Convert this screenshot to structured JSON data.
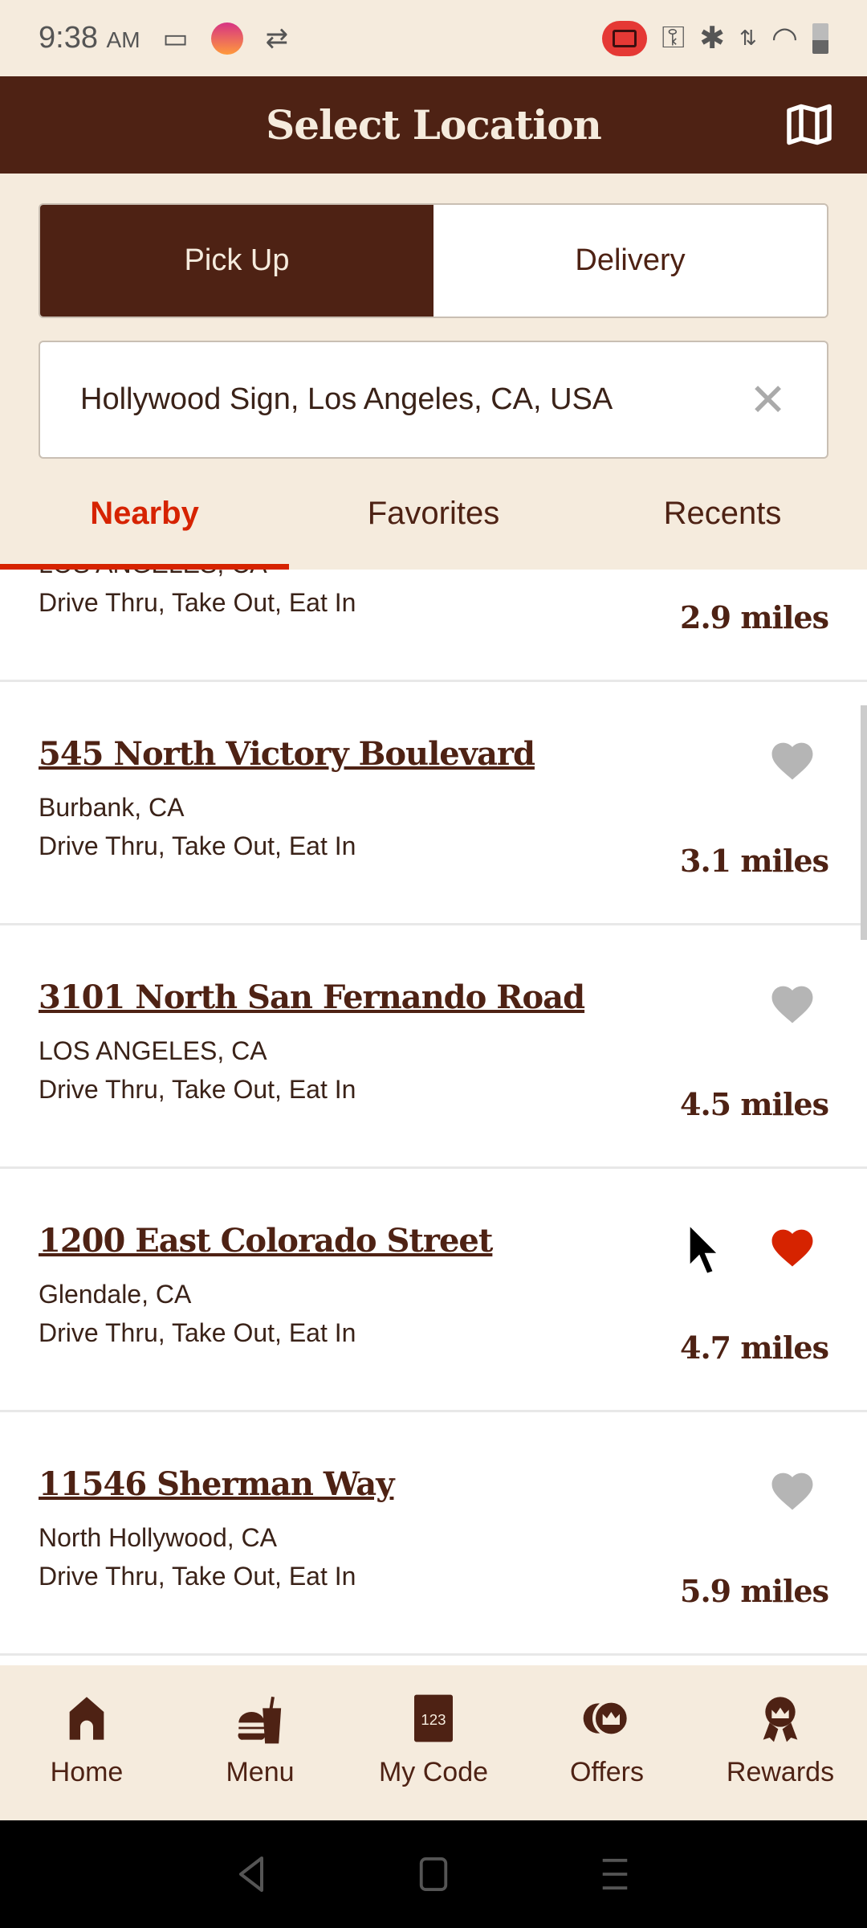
{
  "status_bar": {
    "time": "9:38",
    "ampm": "AM"
  },
  "header": {
    "title": "Select Location",
    "map_icon": "map-icon"
  },
  "mode_toggle": {
    "options": [
      "Pick Up",
      "Delivery"
    ],
    "selected": "Pick Up"
  },
  "search": {
    "value": "Hollywood Sign, Los Angeles, CA, USA"
  },
  "tabs": [
    {
      "label": "Nearby",
      "active": true
    },
    {
      "label": "Favorites"
    },
    {
      "label": "Recents"
    }
  ],
  "locations": [
    {
      "title": "",
      "city": "LOS ANGELES, CA",
      "services": "Drive Thru, Take Out, Eat In",
      "distance": "2.9 miles",
      "favorite": false
    },
    {
      "title": "545 North Victory Boulevard",
      "city": "Burbank, CA",
      "services": "Drive Thru, Take Out, Eat In",
      "distance": "3.1 miles",
      "favorite": false
    },
    {
      "title": "3101 North San Fernando Road",
      "city": "LOS ANGELES, CA",
      "services": "Drive Thru, Take Out, Eat In",
      "distance": "4.5 miles",
      "favorite": false
    },
    {
      "title": "1200 East Colorado Street",
      "city": "Glendale, CA",
      "services": "Drive Thru, Take Out, Eat In",
      "distance": "4.7 miles",
      "favorite": true
    },
    {
      "title": "11546 Sherman Way",
      "city": "North Hollywood, CA",
      "services": "Drive Thru, Take Out, Eat In",
      "distance": "5.9 miles",
      "favorite": false
    }
  ],
  "bottom_nav": [
    {
      "label": "Home",
      "icon": "home-icon"
    },
    {
      "label": "Menu",
      "icon": "menu-icon"
    },
    {
      "label": "My Code",
      "icon": "code-icon",
      "code": "123"
    },
    {
      "label": "Offers",
      "icon": "offers-icon"
    },
    {
      "label": "Rewards",
      "icon": "rewards-icon"
    }
  ],
  "colors": {
    "brand": "#4e2214",
    "accent": "#d62300",
    "background": "#f5ebdd",
    "heart_off": "#b5b5b5"
  }
}
